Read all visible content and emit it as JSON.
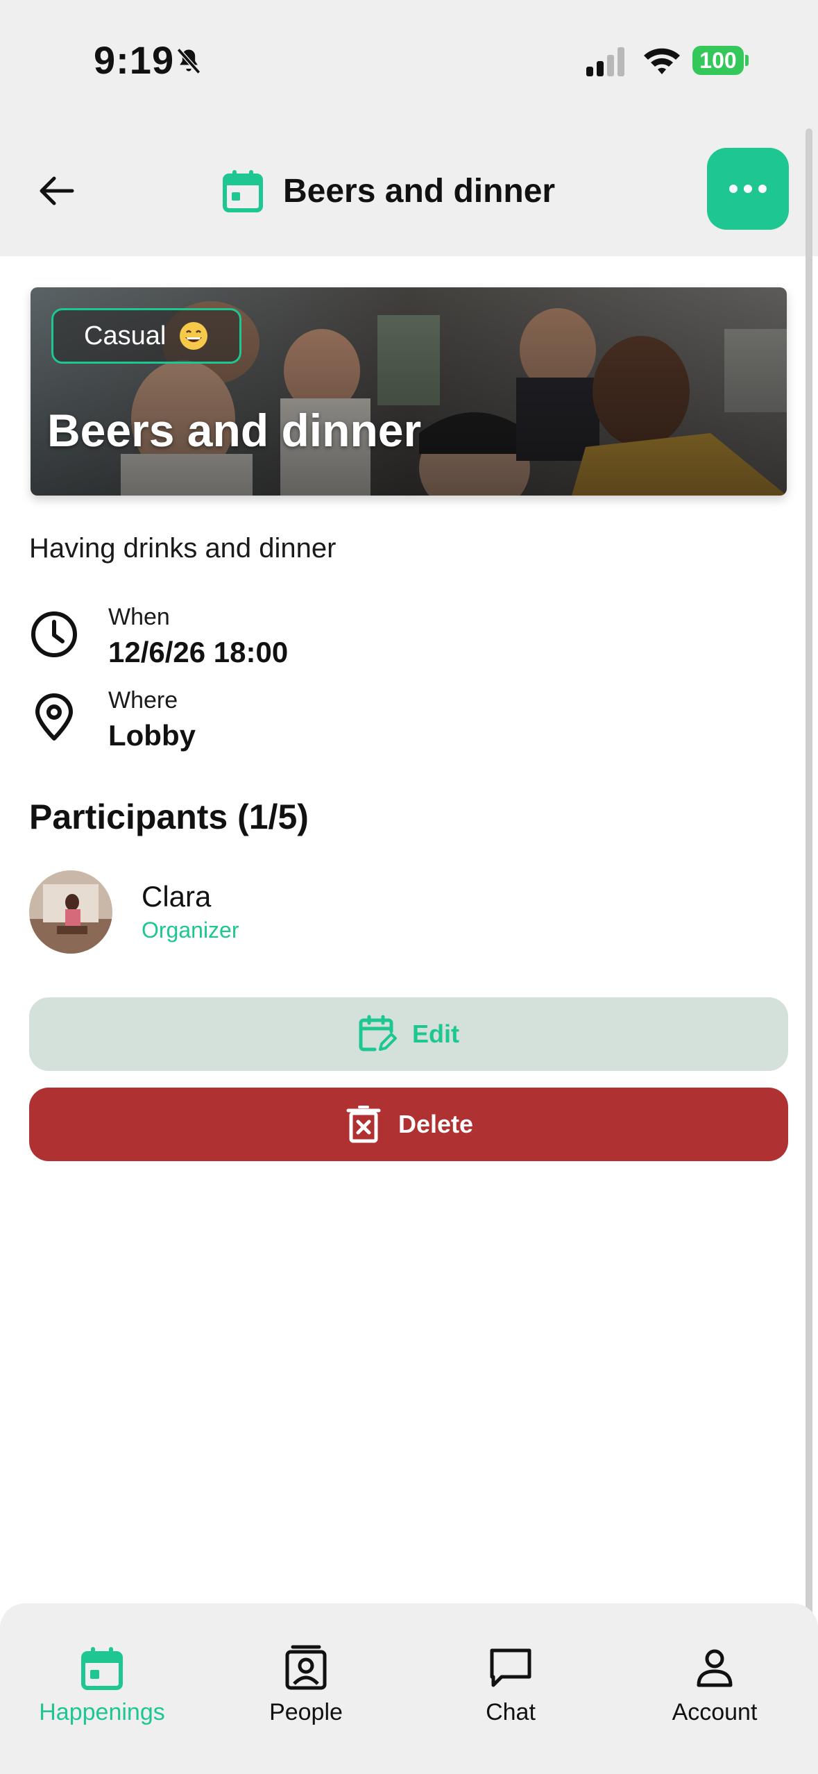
{
  "status_bar": {
    "time": "9:19",
    "battery": "100",
    "silent": true
  },
  "header": {
    "title": "Beers and dinner",
    "back_icon": "arrow-left-icon",
    "title_icon": "calendar-icon",
    "more_icon": "more-horizontal-icon"
  },
  "event": {
    "badge_label": "Casual",
    "badge_emoji": "grinning-face-icon",
    "hero_title": "Beers and dinner",
    "description": "Having drinks and dinner",
    "when_label": "When",
    "when_value": "12/6/26 18:00",
    "where_label": "Where",
    "where_value": "Lobby"
  },
  "participants": {
    "heading": "Participants (1/5)",
    "list": [
      {
        "name": "Clara",
        "role": "Organizer"
      }
    ]
  },
  "actions": {
    "edit_label": "Edit",
    "delete_label": "Delete"
  },
  "bottom_nav": {
    "items": [
      {
        "label": "Happenings",
        "icon": "calendar-icon",
        "active": true
      },
      {
        "label": "People",
        "icon": "contact-icon",
        "active": false
      },
      {
        "label": "Chat",
        "icon": "chat-bubble-icon",
        "active": false
      },
      {
        "label": "Account",
        "icon": "person-icon",
        "active": false
      }
    ]
  },
  "colors": {
    "accent": "#1ec692",
    "danger": "#b03131",
    "edit_bg": "#d4e0da",
    "chrome_bg": "#efefef"
  }
}
